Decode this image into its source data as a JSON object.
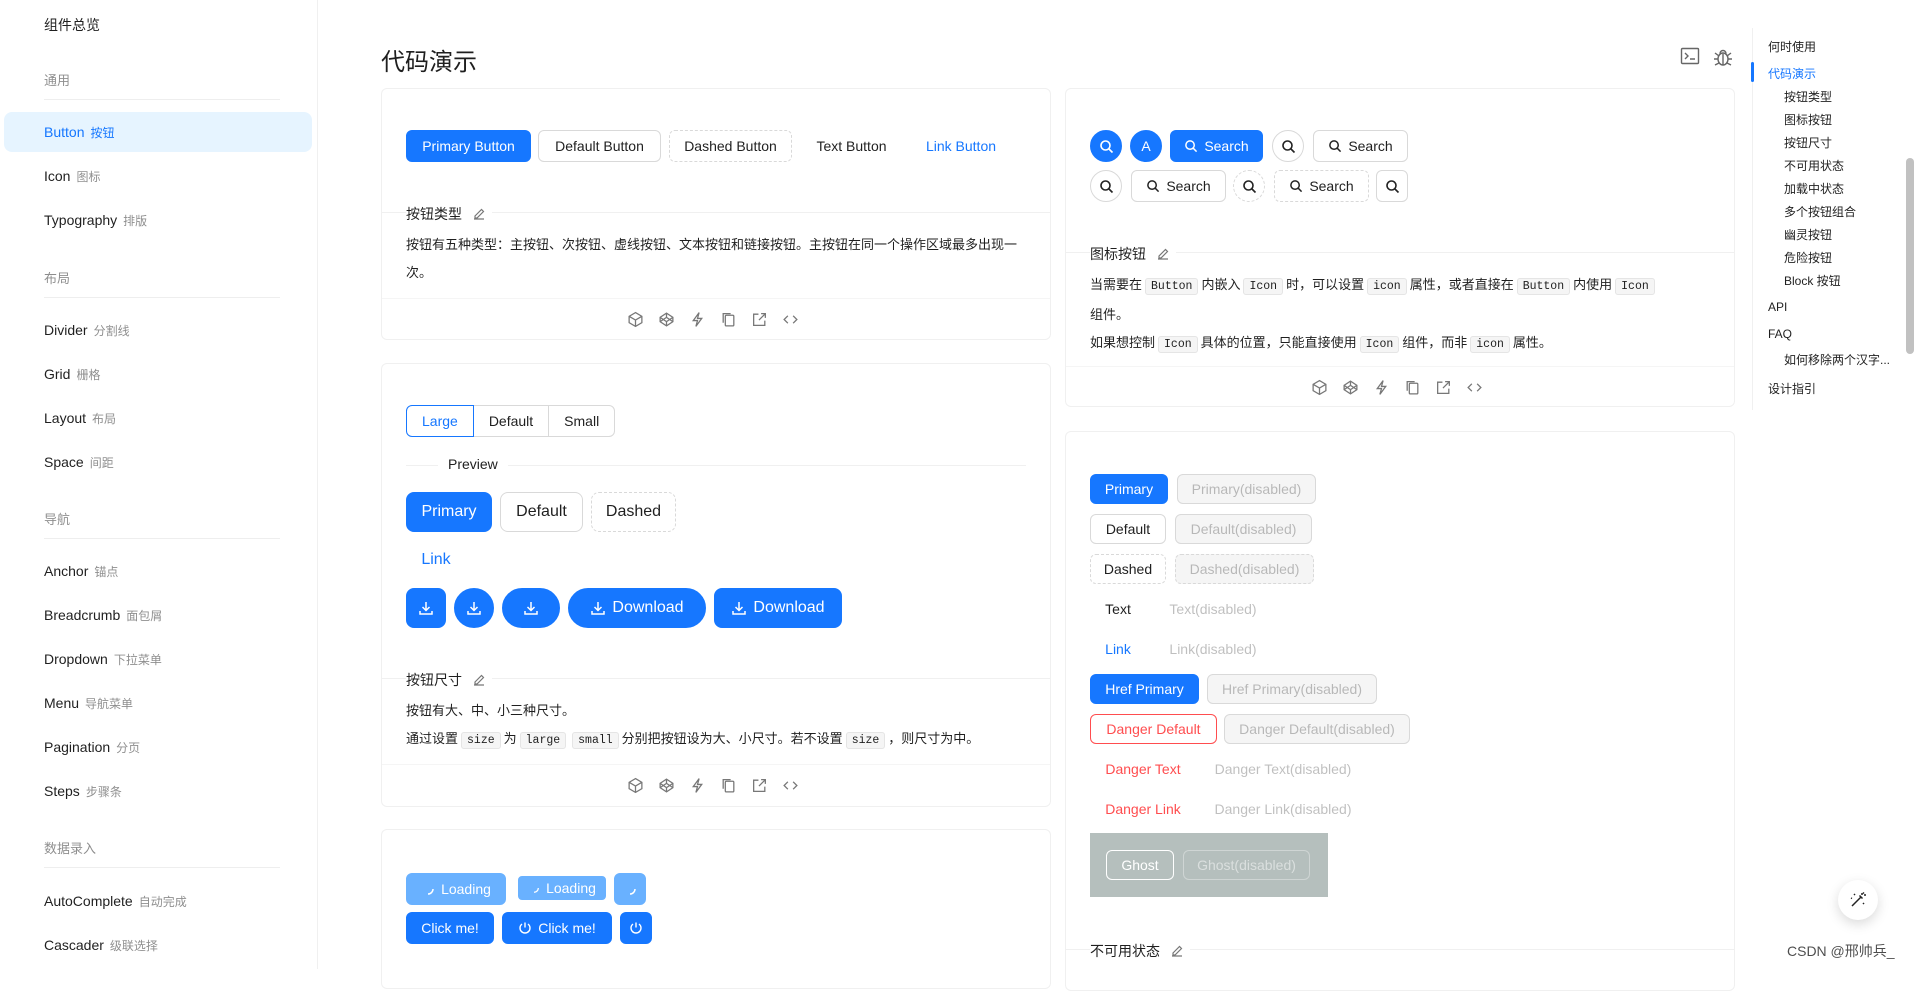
{
  "sidebar": {
    "top_item": "组件总览",
    "groups": [
      {
        "title": "通用"
      },
      {
        "title": "布局"
      },
      {
        "title": "导航"
      },
      {
        "title": "数据录入"
      }
    ],
    "items": [
      {
        "label": "Button",
        "sub": "按钮"
      },
      {
        "label": "Icon",
        "sub": "图标"
      },
      {
        "label": "Typography",
        "sub": "排版"
      },
      {
        "label": "Divider",
        "sub": "分割线"
      },
      {
        "label": "Grid",
        "sub": "栅格"
      },
      {
        "label": "Layout",
        "sub": "布局"
      },
      {
        "label": "Space",
        "sub": "间距"
      },
      {
        "label": "Anchor",
        "sub": "锚点"
      },
      {
        "label": "Breadcrumb",
        "sub": "面包屑"
      },
      {
        "label": "Dropdown",
        "sub": "下拉菜单"
      },
      {
        "label": "Menu",
        "sub": "导航菜单"
      },
      {
        "label": "Pagination",
        "sub": "分页"
      },
      {
        "label": "Steps",
        "sub": "步骤条"
      },
      {
        "label": "AutoComplete",
        "sub": "自动完成"
      },
      {
        "label": "Cascader",
        "sub": "级联选择"
      }
    ]
  },
  "page": {
    "title": "代码演示"
  },
  "demo_types": {
    "buttons": [
      "Primary Button",
      "Default Button",
      "Dashed Button",
      "Text Button",
      "Link Button"
    ],
    "meta_title": "按钮类型",
    "desc": "按钮有五种类型：主按钮、次按钮、虚线按钮、文本按钮和链接按钮。主按钮在同一个操作区域最多出现一次。"
  },
  "demo_icon": {
    "circle_letter": "A",
    "search_label": "Search",
    "meta_title": "图标按钮",
    "desc1_a": "当需要在",
    "code_button": "Button",
    "desc1_b": "内嵌入",
    "code_icon": "Icon",
    "desc1_c": "时，可以设置",
    "code_icon_prop": "icon",
    "desc1_d": "属性，或者直接在",
    "desc1_e": "内使用",
    "desc1_f": "组件。",
    "desc2_a": "如果想控制",
    "desc2_b": "具体的位置，只能直接使用",
    "desc2_c": "组件，而非",
    "desc2_d": "属性。"
  },
  "demo_size": {
    "segments": [
      "Large",
      "Default",
      "Small"
    ],
    "preview": "Preview",
    "buttons": [
      "Primary",
      "Default",
      "Dashed"
    ],
    "link": "Link",
    "download": "Download",
    "meta_title": "按钮尺寸",
    "desc1": "按钮有大、中、小三种尺寸。",
    "desc2_a": "通过设置",
    "code_size": "size",
    "desc2_b": "为",
    "code_large": "large",
    "code_small": "small",
    "desc2_c": "分别把按钮设为大、小尺寸。若不设置",
    "desc2_d": "，则尺寸为中。"
  },
  "demo_loading": {
    "loading": "Loading",
    "click": "Click me!"
  },
  "demo_disabled": {
    "rows": [
      {
        "label": "Primary",
        "disabled": "Primary(disabled)"
      },
      {
        "label": "Default",
        "disabled": "Default(disabled)"
      },
      {
        "label": "Dashed",
        "disabled": "Dashed(disabled)"
      },
      {
        "label": "Text",
        "disabled": "Text(disabled)"
      },
      {
        "label": "Link",
        "disabled": "Link(disabled)"
      },
      {
        "label": "Href Primary",
        "disabled": "Href Primary(disabled)"
      },
      {
        "label": "Danger Default",
        "disabled": "Danger Default(disabled)"
      },
      {
        "label": "Danger Text",
        "disabled": "Danger Text(disabled)"
      },
      {
        "label": "Danger Link",
        "disabled": "Danger Link(disabled)"
      },
      {
        "label": "Ghost",
        "disabled": "Ghost(disabled)"
      }
    ],
    "meta_title": "不可用状态"
  },
  "toc": {
    "items": [
      "何时使用",
      "代码演示",
      "按钮类型",
      "图标按钮",
      "按钮尺寸",
      "不可用状态",
      "加载中状态",
      "多个按钮组合",
      "幽灵按钮",
      "危险按钮",
      "Block 按钮",
      "API",
      "FAQ",
      "如何移除两个汉字...",
      "设计指引"
    ]
  },
  "watermark": "CSDN @邢帅兵_",
  "colors": {
    "primary": "#1677ff",
    "danger": "#ff4d4f",
    "active_bg": "#e6f4ff"
  }
}
